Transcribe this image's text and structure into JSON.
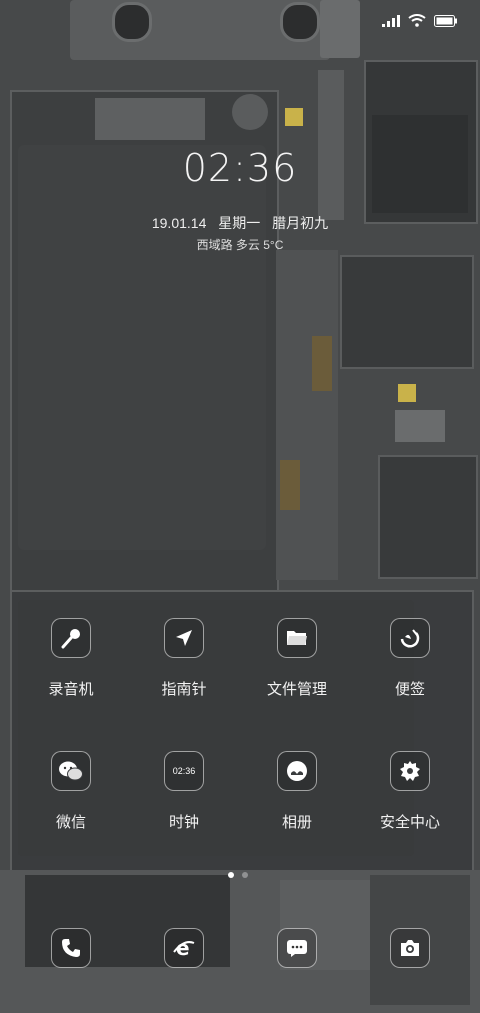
{
  "lockscreen": {
    "time": "02:36",
    "date": "19.01.14",
    "weekday": "星期一",
    "lunar": "腊月初九",
    "weather": "西域路 多云 5°C"
  },
  "apps": [
    {
      "label": "录音机",
      "icon": "microphone-icon"
    },
    {
      "label": "指南针",
      "icon": "compass-arrow-icon"
    },
    {
      "label": "文件管理",
      "icon": "folder-icon"
    },
    {
      "label": "便签",
      "icon": "notes-icon"
    },
    {
      "label": "微信",
      "icon": "wechat-icon"
    },
    {
      "label": "时钟",
      "icon": "clock-icon",
      "icon_text": "02:36"
    },
    {
      "label": "相册",
      "icon": "gallery-icon"
    },
    {
      "label": "安全中心",
      "icon": "security-icon"
    }
  ],
  "dock": [
    {
      "icon": "phone-icon"
    },
    {
      "icon": "browser-icon"
    },
    {
      "icon": "messages-icon"
    },
    {
      "icon": "camera-icon"
    }
  ],
  "pages": {
    "count": 2,
    "current": 1
  },
  "colors": {
    "background": "#4a4c4d",
    "panel": "#3a3c3e",
    "accent": "#c9b24a"
  }
}
